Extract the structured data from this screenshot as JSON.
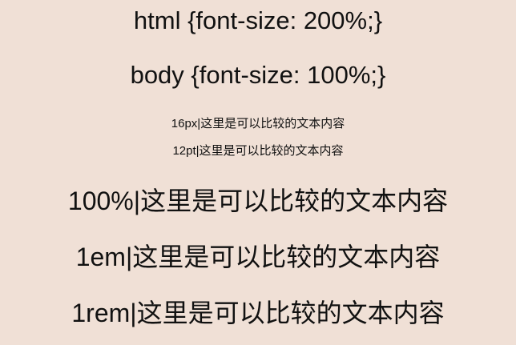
{
  "lines": {
    "html_rule": "html {font-size: 200%;}",
    "body_rule": "body {font-size: 100%;}",
    "px_sample": "16px|这里是可以比较的文本内容",
    "pt_sample": "12pt|这里是可以比较的文本内容",
    "percent_sample": "100%|这里是可以比较的文本内容",
    "em_sample": "1em|这里是可以比较的文本内容",
    "rem_sample": "1rem|这里是可以比较的文本内容"
  },
  "colors": {
    "background": "#f0e0d6",
    "text": "#111111"
  }
}
